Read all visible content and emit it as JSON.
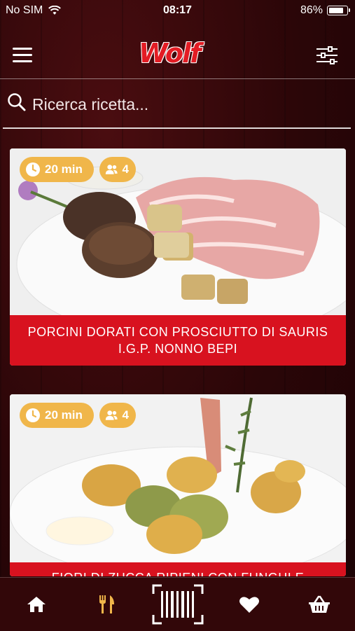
{
  "status_bar": {
    "carrier": "No SIM",
    "time": "08:17",
    "battery": "86%"
  },
  "header": {
    "logo": "Wolf"
  },
  "search": {
    "placeholder": "Ricerca ricetta..."
  },
  "recipes": [
    {
      "time": "20 min",
      "people": "4",
      "title_line1": "PORCINI DORATI  CON PROSCIUTTO DI SAURIS",
      "title_line2": "I.G.P. NONNO BEPI"
    },
    {
      "time": "20 min",
      "people": "4",
      "title_line1": "FIORI DI ZUCCA RIPIENI  CON FUNGHI E"
    }
  ],
  "tabbar": {
    "active_color": "#f0b64a",
    "items": [
      "home-icon",
      "recipes-icon",
      "barcode-scan-icon",
      "favorites-icon",
      "basket-icon"
    ]
  }
}
